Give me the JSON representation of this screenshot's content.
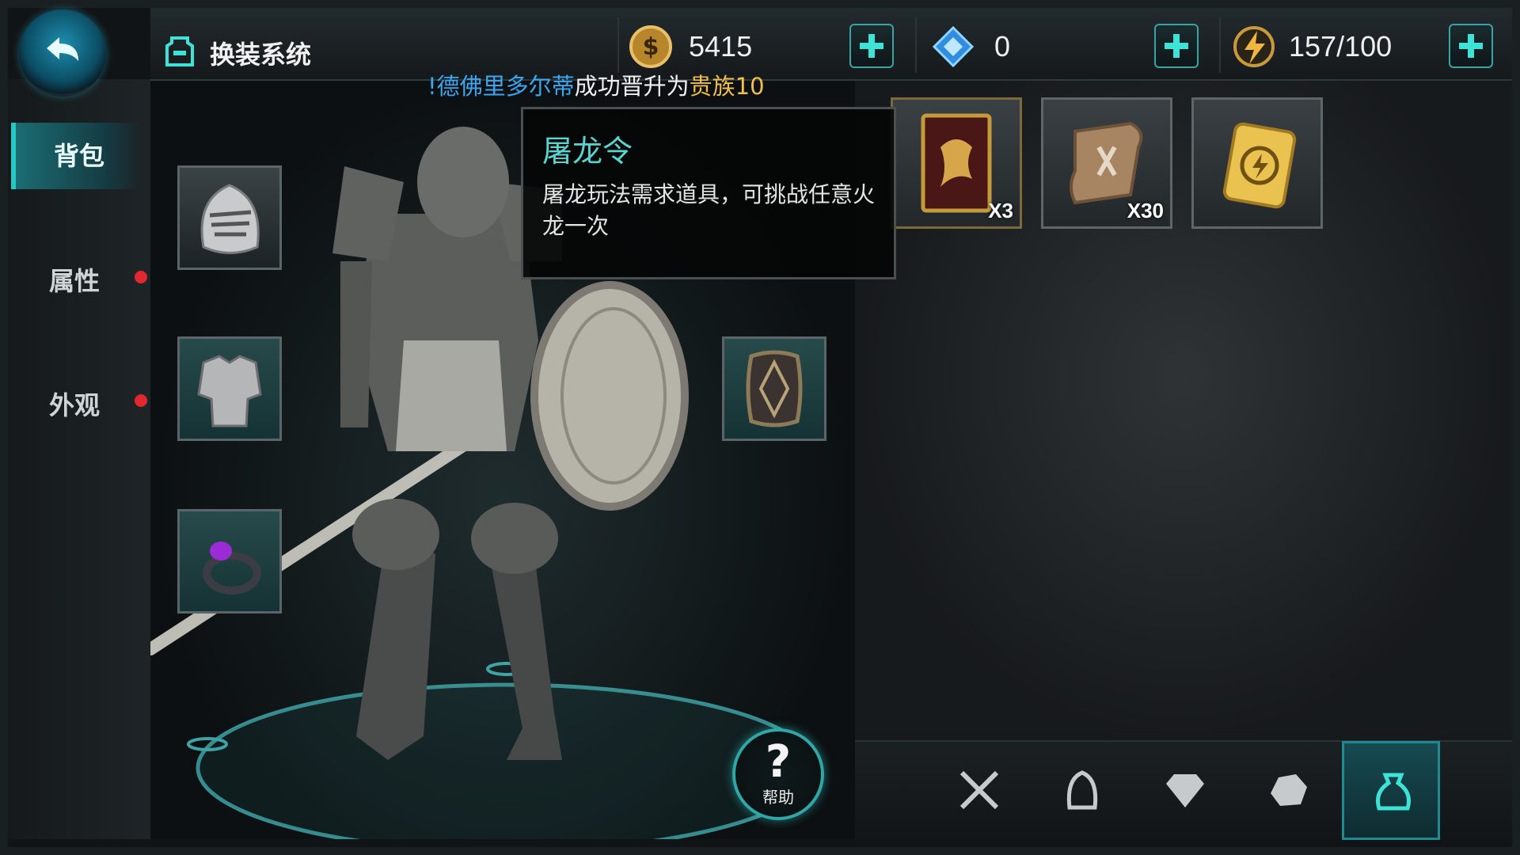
{
  "header": {
    "title": "换装系统",
    "gold": "5415",
    "gems": "0",
    "energy": "157/100"
  },
  "news": {
    "part1": "!德佛里多尔蒂",
    "part2": "成功晋升为",
    "part3": "贵族10"
  },
  "sidebar": {
    "items": [
      {
        "label": "背包"
      },
      {
        "label": "属性"
      },
      {
        "label": "外观"
      }
    ]
  },
  "tooltip": {
    "title": "屠龙令",
    "description": "屠龙玩法需求道具，可挑战任意火龙一次"
  },
  "inventory": {
    "items": [
      {
        "icon": "dragon-card-icon",
        "count": "X3"
      },
      {
        "icon": "scroll-icon",
        "count": "X30"
      },
      {
        "icon": "energy-card-icon",
        "count": ""
      }
    ]
  },
  "categories": [
    {
      "icon": "weapon-icon"
    },
    {
      "icon": "helmet-icon"
    },
    {
      "icon": "gem-icon"
    },
    {
      "icon": "ore-icon"
    },
    {
      "icon": "bag-icon",
      "active": true
    }
  ],
  "help": {
    "label": "帮助"
  },
  "colors": {
    "accent": "#3ee2d6",
    "news_name": "#3aa7f0",
    "news_rank": "#f0c04a",
    "alert": "#e0282e"
  }
}
